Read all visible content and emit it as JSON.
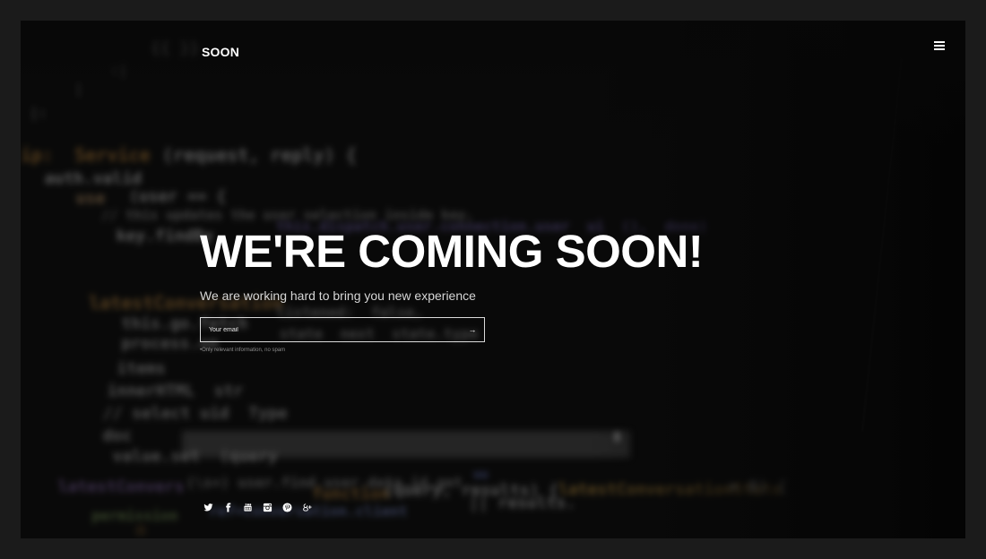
{
  "brand": {
    "logo": "SOON"
  },
  "hero": {
    "title": "WE'RE COMING SOON!",
    "subtitle": "We are working hard to bring you new experience"
  },
  "subscribe": {
    "placeholder": "Your email",
    "submit_label": "→",
    "note": "•Only relevant information, no spam"
  },
  "social": [
    {
      "name": "twitter-icon"
    },
    {
      "name": "facebook-icon"
    },
    {
      "name": "youtube-icon"
    },
    {
      "name": "instagram-icon"
    },
    {
      "name": "pinterest-icon"
    },
    {
      "name": "google-plus-icon"
    }
  ],
  "colors": {
    "page_background": "#1b1b1b",
    "text_primary": "#ffffff",
    "text_secondary": "#d6d6d6",
    "note": "#8a8a8a"
  }
}
